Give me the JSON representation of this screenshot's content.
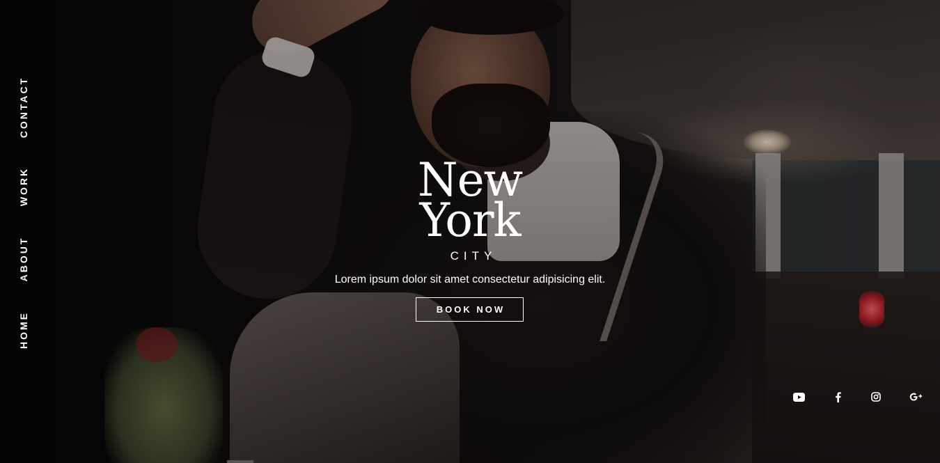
{
  "nav": {
    "items": [
      {
        "label": "CONTACT"
      },
      {
        "label": "WORK"
      },
      {
        "label": "ABOUT"
      },
      {
        "label": "HOME"
      }
    ]
  },
  "hero": {
    "title_line1": "New",
    "title_line2": "York",
    "subtitle": "CITY",
    "tagline": "Lorem ipsum dolor sit amet consectetur adipisicing elit.",
    "cta_label": "BOOK NOW"
  },
  "social": {
    "icons": [
      "youtube-icon",
      "facebook-icon",
      "instagram-icon",
      "google-plus-icon"
    ]
  },
  "colors": {
    "text": "#ffffff",
    "background": "#0b0909"
  }
}
